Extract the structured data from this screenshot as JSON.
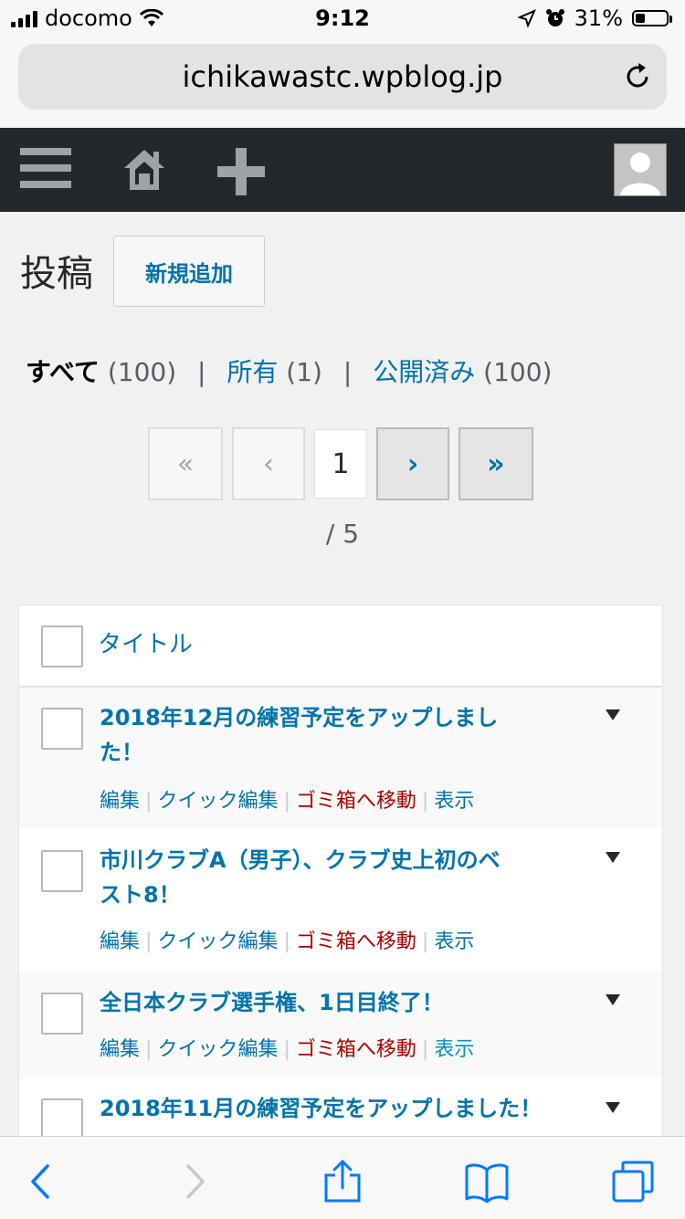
{
  "status_bar": {
    "carrier": "docomo",
    "time": "9:12",
    "battery_text": "31%",
    "battery_level": 0.31
  },
  "browser": {
    "url": "ichikawastc.wpblog.jp"
  },
  "admin_bar": {
    "menu_icon": "menu-icon",
    "home_icon": "home-icon",
    "add_icon": "plus-icon",
    "avatar_icon": "user-avatar-icon"
  },
  "header": {
    "title": "投稿",
    "add_new_label": "新規追加"
  },
  "filters": {
    "all_label": "すべて",
    "all_count": "(100)",
    "separator": "|",
    "mine_label": "所有",
    "mine_count": "(1)",
    "published_label": "公開済み",
    "published_count": "(100)"
  },
  "pagination": {
    "first": "«",
    "prev": "‹",
    "current": "1",
    "next": "›",
    "last": "»",
    "total": "/ 5"
  },
  "table": {
    "column_title": "タイトル",
    "actions": {
      "edit": "編集",
      "quick_edit": "クイック編集",
      "trash": "ゴミ箱へ移動",
      "view": "表示",
      "separator": "|"
    },
    "rows": [
      {
        "title_line1": "2018年12月の練習予定をアップしまし",
        "title_line2": "た！"
      },
      {
        "title_line1": "市川クラブA（男子）、クラブ史上初のベ",
        "title_line2": "スト8！"
      },
      {
        "title_line1": "全日本クラブ選手権、1日目終了！"
      },
      {
        "title_line1": "2018年11月の練習予定をアップしました！"
      }
    ]
  },
  "colors": {
    "link": "#0073aa",
    "trash": "#aa0000",
    "adminbar": "#23282d",
    "ios_blue": "#007aff"
  }
}
